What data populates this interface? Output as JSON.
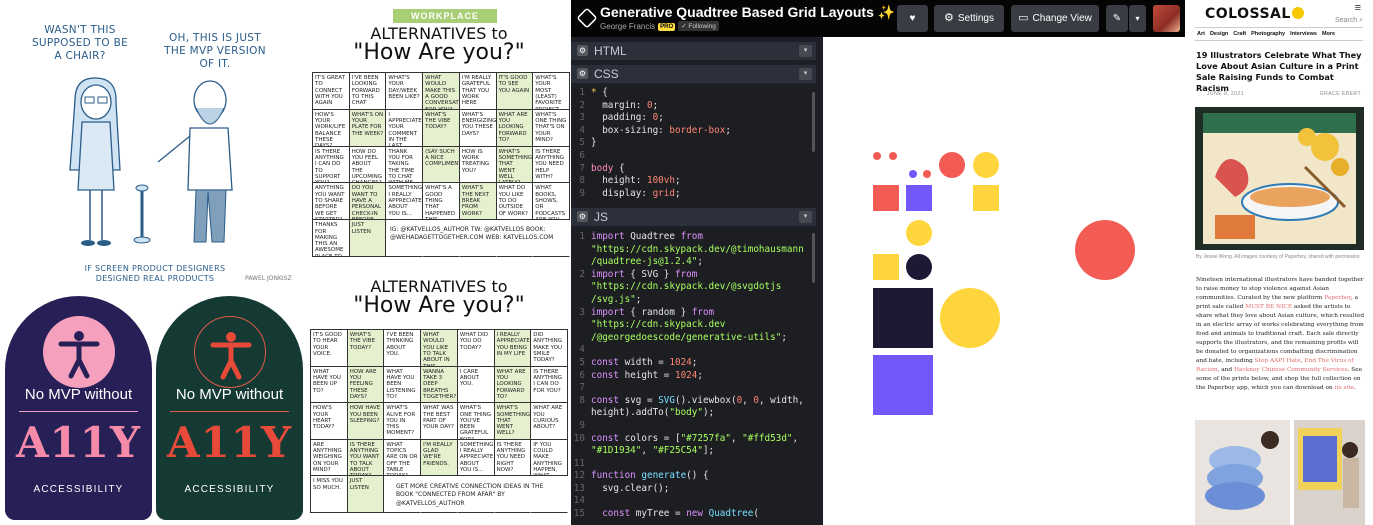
{
  "comic": {
    "caption_left": "WASN'T THIS SUPPOSED TO BE A CHAIR?",
    "caption_right": "OH, THIS IS JUST THE MVP VERSION OF IT.",
    "footer": "IF SCREEN PRODUCT DESIGNERS DESIGNED REAL PRODUCTS",
    "signature": "PAWEL JONKISZ"
  },
  "stickers": [
    {
      "tag": "No MVP without",
      "big": "A11Y",
      "sub": "ACCESSIBILITY"
    },
    {
      "tag": "No MVP without",
      "big": "A11Y",
      "sub": "ACCESSIBILITY"
    }
  ],
  "worksheet_top": {
    "badge": "WORKPLACE",
    "title_small": "ALTERNATIVES to",
    "title_big": "\"How Are you?\"",
    "cells": [
      "IT'S GREAT TO CONNECT WITH YOU AGAIN",
      "I'VE BEEN LOOKING FORWARD TO THIS CHAT",
      "WHAT'S YOUR DAY/WEEK BEEN LIKE?",
      "WHAT WOULD MAKE THIS A GOOD CONVERSATION FOR YOU?",
      "I'M REALLY GRATEFUL THAT YOU WORK HERE",
      "IT'S GOOD TO SEE YOU AGAIN",
      "WHAT'S YOUR MOST (LEAST) FAVORITE PROJECT LATELY?",
      "HOW'S YOUR WORK/LIFE BALANCE THESE DAYS?",
      "WHAT'S ON YOUR PLATE FOR THE WEEK?",
      "I APPRECIATED YOUR COMMENT IN THE LAST MEETING",
      "WHAT'S THE VIBE TODAY?",
      "WHAT'S ENERGIZING YOU THESE DAYS?",
      "WHAT ARE YOU LOOKING FORWARD TO?",
      "WHAT'S ONE THING THAT'S ON YOUR MIND?",
      "IS THERE ANYTHING I CAN DO TO SUPPORT YOU?",
      "HOW DO YOU FEEL ABOUT THE UPCOMING CHANGES?",
      "THANK YOU FOR TAKING THE TIME TO CHAT WITH ME",
      "(SAY SUCH A NICE COMPLIMENT)",
      "HOW IS WORK TREATING YOU?",
      "WHAT'S SOMETHING THAT WENT WELL LATELY?",
      "IS THERE ANYTHING YOU NEED HELP WITH?",
      "ANYTHING YOU WANT TO SHARE BEFORE WE GET STARTED?",
      "DO YOU WANT TO HAVE A PERSONAL CHECK-IN BEFORE WE BEGIN?",
      "SOMETHING I REALLY APPRECIATE ABOUT YOU IS...",
      "WHAT'S A GOOD THING THAT HAPPENED THIS WEEK?",
      "WHAT'S THE NEXT BREAK FROM WORK?",
      "WHAT DO YOU LIKE TO DO OUTSIDE OF WORK?",
      "WHAT BOOKS, SHOWS, OR PODCASTS ARE YOU INTO?",
      "THANKS FOR MAKING THIS AN AWESOME PLACE TO WORK",
      "JUST LISTEN",
      "",
      "",
      "",
      "",
      ""
    ],
    "note": "IG: @KATVELLOS_AUTHOR  TW: @KATVELLOS  BOOK: @WEHADAGETTOGETHER.COM  WEB: KATVELLOS.COM"
  },
  "worksheet_bottom": {
    "title_small": "ALTERNATIVES to",
    "title_big": "\"How Are you?\"",
    "cells": [
      "IT'S GOOD TO HEAR YOUR VOICE.",
      "WHAT'S THE VIBE TODAY?",
      "I'VE BEEN THINKING ABOUT YOU.",
      "WHAT WOULD YOU LIKE TO TALK ABOUT IN THIS CHAT?",
      "WHAT DID YOU DO TODAY?",
      "I REALLY APPRECIATE YOU BEING IN MY LIFE",
      "DID ANYTHING MAKE YOU SMILE TODAY?",
      "WHAT HAVE YOU BEEN UP TO?",
      "HOW ARE YOU FEELING THESE DAYS?",
      "WHAT HAVE YOU BEEN LISTENING TO?",
      "WANNA TAKE 3 DEEP BREATHS TOGETHER?",
      "I CARE ABOUT YOU.",
      "WHAT ARE YOU LOOKING FORWARD TO?",
      "IS THERE ANYTHING I CAN DO FOR YOU?",
      "HOW'S YOUR HEART TODAY?",
      "HOW HAVE YOU BEEN SLEEPING?",
      "WHAT'S ALIVE FOR YOU IN THIS MOMENT?",
      "WHAT WAS THE BEST PART OF YOUR DAY?",
      "WHAT'S ONE THING YOU'VE BEEN GRATEFUL FOR?",
      "WHAT'S SOMETHING THAT WENT WELL?",
      "WHAT ARE YOU CURIOUS ABOUT?",
      "ARE ANYTHING WEIGHING ON YOUR MIND?",
      "IS THERE ANYTHING YOU WANT TO TALK ABOUT TODAY?",
      "WHAT TOPICS ARE ON OR OFF THE TABLE TODAY?",
      "I'M REALLY GLAD WE'RE FRIENDS.",
      "SOMETHING I REALLY APPRECIATE ABOUT YOU IS...",
      "IS THERE ANYTHING YOU NEED RIGHT NOW?",
      "IF YOU COULD MAKE ANYTHING HAPPEN, WHAT WOULD IT BE?",
      "I MISS YOU SO MUCH.",
      "JUST LISTEN",
      "",
      "",
      "",
      "",
      ""
    ],
    "note": "GET MORE CREATIVE CONNECTION IDEAS IN THE BOOK \"CONNECTED FROM AFAR\" BY @KATVELLOS_AUTHOR"
  },
  "codepen": {
    "title": "Generative Quadtree Based Grid Layouts ✨",
    "author": "George Francis",
    "pro_badge": "PRO",
    "following": "✓ Following",
    "buttons": {
      "settings": "Settings",
      "change_view": "Change View"
    },
    "panes": {
      "html": "HTML",
      "css": "CSS",
      "js": "JS"
    },
    "colors": [
      "#7257fa",
      "#ffd53d",
      "#1D1934",
      "#F25C54"
    ]
  },
  "colossal": {
    "logo": "COLOSSAL",
    "search": "Search",
    "nav": [
      "Art",
      "Design",
      "Craft",
      "Photography",
      "Interviews",
      "More"
    ],
    "headline": "19 Illustrators Celebrate What They Love About Asian Culture in a Print Sale Raising Funds to Combat Racism",
    "date": "JUNE 9, 2021",
    "author": "GRACE EBERT",
    "caption": "By Jessie Wong. All images courtesy of Paperboy, shared with permission",
    "body_1": "Nineteen international illustrators have banded together to raise money to stop violence against Asian communities. Curated by the new platform ",
    "link_1": "Paperboy",
    "body_2": ", a print sale called ",
    "link_2": "MUST BE NICE",
    "body_3": " asked the artists to share what they love about Asian culture, which resulted in an electric array of works celebrating everything from food and animals to traditional craft. Each sale directly supports the illustrators, and the remaining profits will be donated to organizations combatting discrimination and hate, including ",
    "link_3": "Stop AAPI Hate",
    "body_4": ", ",
    "link_4": "End The Virus of Racism",
    "body_5": ", and ",
    "link_5": "Hackney Chinese Community Services",
    "body_6": ". See some of the prints below, and shop the full collection on the Paperboy app, which you can download on ",
    "link_6": "its site",
    "body_7": "."
  }
}
